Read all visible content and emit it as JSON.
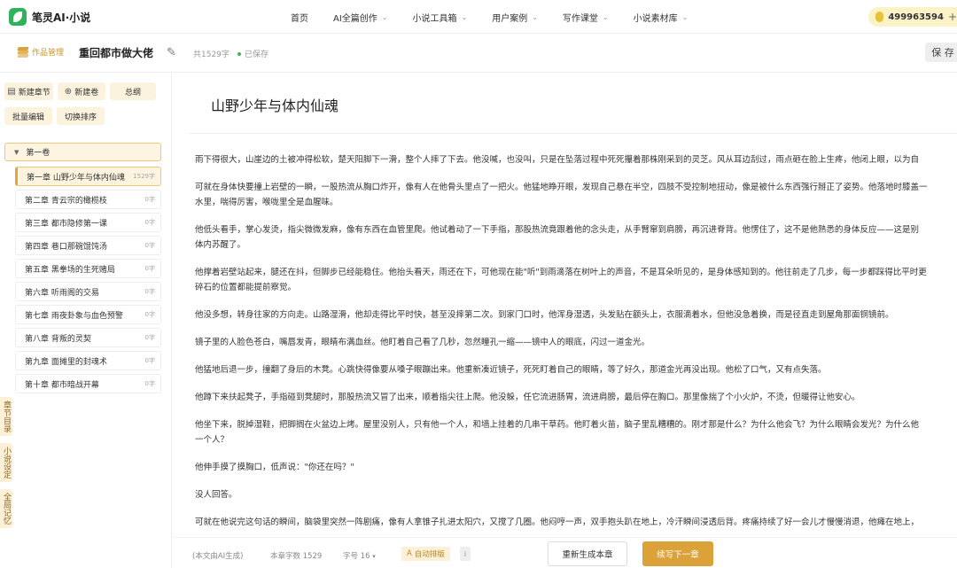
{
  "app": {
    "name": "笔灵AI·小说"
  },
  "nav": {
    "items": [
      {
        "label": "首页",
        "dropdown": false
      },
      {
        "label": "AI全篇创作",
        "dropdown": true
      },
      {
        "label": "小说工具箱",
        "dropdown": true
      },
      {
        "label": "用户案例",
        "dropdown": true
      },
      {
        "label": "写作课堂",
        "dropdown": true
      },
      {
        "label": "小说素材库",
        "dropdown": true
      }
    ],
    "user_credits": "499963594"
  },
  "docbar": {
    "works_manager": "作品管理",
    "title": "重回都市做大佬",
    "word_count": "共1529字",
    "status": "已保存",
    "save_label": "保 存"
  },
  "sidebar": {
    "tools": {
      "new_chapter": "新建章节",
      "new_volume": "新建卷",
      "outline": "总纲",
      "batch_edit": "批量编辑",
      "toggle_sort": "切换排序"
    },
    "volume": "第一卷",
    "chapters": [
      {
        "label": "第一章 山野少年与体内仙魂",
        "count": "1529字",
        "active": true
      },
      {
        "label": "第二章 青云宗的橄榄枝",
        "count": "0字"
      },
      {
        "label": "第三章 都市隐修第一课",
        "count": "0字"
      },
      {
        "label": "第四章 巷口那碗馄饨汤",
        "count": "0字"
      },
      {
        "label": "第五章 黑拳场的生死赌局",
        "count": "0字"
      },
      {
        "label": "第六章 听雨阁的交易",
        "count": "0字"
      },
      {
        "label": "第七章 雨夜卦象与血色预警",
        "count": "0字"
      },
      {
        "label": "第八章 背叛的灵契",
        "count": "0字"
      },
      {
        "label": "第九章 面摊里的封魂术",
        "count": "0字"
      },
      {
        "label": "第十章 都市暗战开幕",
        "count": "0字"
      }
    ],
    "tabs": [
      "章节目录",
      "小说设定",
      "全局记忆"
    ]
  },
  "editor": {
    "chapter_title": "山野少年与体内仙魂",
    "paragraphs": [
      {
        "lines": [
          "雨下得很大，山崖边的土被冲得松软，楚天阳脚下一滑，整个人摔了下去。他没喊，也没叫，只是在坠落过程中死死攥着那株刚采到的灵芝。风从耳边刮过，雨点砸在脸上生疼，他闭上眼，以为自"
        ]
      },
      {
        "lines": [
          "可就在身体快要撞上岩壁的一瞬，一股热流从胸口炸开，像有人在他骨头里点了一把火。他猛地睁开眼，发现自己悬在半空，四肢不受控制地扭动，像是被什么东西强行掰正了姿势。他落地时膝盖一",
          "水里，喘得厉害，喉咙里全是血腥味。"
        ]
      },
      {
        "lines": [
          "他低头看手，掌心发烫，指尖微微发麻，像有东西在血管里爬。他试着动了一下手指，那股热流竟跟着他的念头走，从手臂窜到肩膀，再沉进脊背。他愣住了，这不是他熟悉的身体反应——这是别",
          "体内苏醒了。"
        ]
      },
      {
        "lines": [
          "他撑着岩壁站起来，腿还在抖，但脚步已经能稳住。他抬头看天，雨还在下，可他现在能\"听\"到雨滴落在树叶上的声音，不是耳朵听见的，是身体感知到的。他往前走了几步，每一步都踩得比平时更",
          "碎石的位置都能提前察觉。"
        ]
      },
      {
        "lines": [
          "他没多想，转身往家的方向走。山路湿滑，他却走得比平时快，甚至没摔第二次。到家门口时，他浑身湿透，头发贴在额头上，衣服滴着水，但他没急着换，而是径直走到屋角那面铜镜前。"
        ]
      },
      {
        "lines": [
          "镜子里的人脸色苍白，嘴唇发青，眼睛布满血丝。他盯着自己看了几秒，忽然瞳孔一缩——镜中人的眼底，闪过一道金光。"
        ]
      },
      {
        "lines": [
          "他猛地后退一步，撞翻了身后的木凳。心跳快得像要从嗓子眼蹦出来。他重新凑近镜子，死死盯着自己的眼睛，等了好久，那道金光再没出现。他松了口气，又有点失落。"
        ]
      },
      {
        "lines": [
          "他蹲下来扶起凳子，手指碰到凳腿时，那股热流又冒了出来，顺着指尖往上爬。他没躲，任它流进肠胃，流进肩膀，最后停在胸口。那里像揣了个小火炉，不烫，但暖得让他安心。"
        ]
      },
      {
        "lines": [
          "他坐下来，脱掉湿鞋，把脚搁在火盆边上烤。屋里没别人，只有他一个人，和墙上挂着的几串干草药。他盯着火苗，脑子里乱糟糟的。刚才那是什么？为什么他会飞？为什么眼睛会发光？为什么他",
          "一个人？"
        ]
      },
      {
        "lines": [
          "他伸手摸了摸胸口，低声说：\"你还在吗？\""
        ]
      },
      {
        "lines": [
          "没人回答。"
        ]
      },
      {
        "lines": [
          "可就在他说完这句话的瞬间，脑袋里突然一阵剧痛，像有人拿锥子扎进太阳穴，又搅了几圈。他闷哼一声，双手抱头趴在地上，冷汗瞬间浸透后背。疼痛持续了好一会儿才慢慢消退，他瘫在地上，"
        ]
      }
    ]
  },
  "bottombar": {
    "ai_note": "(本文由AI生成)",
    "chapter_words": "本章字数 1529",
    "font_size": "字号 16",
    "auto_format": "自动排版",
    "info": "i",
    "regenerate": "重新生成本章",
    "continue": "续写下一章"
  }
}
